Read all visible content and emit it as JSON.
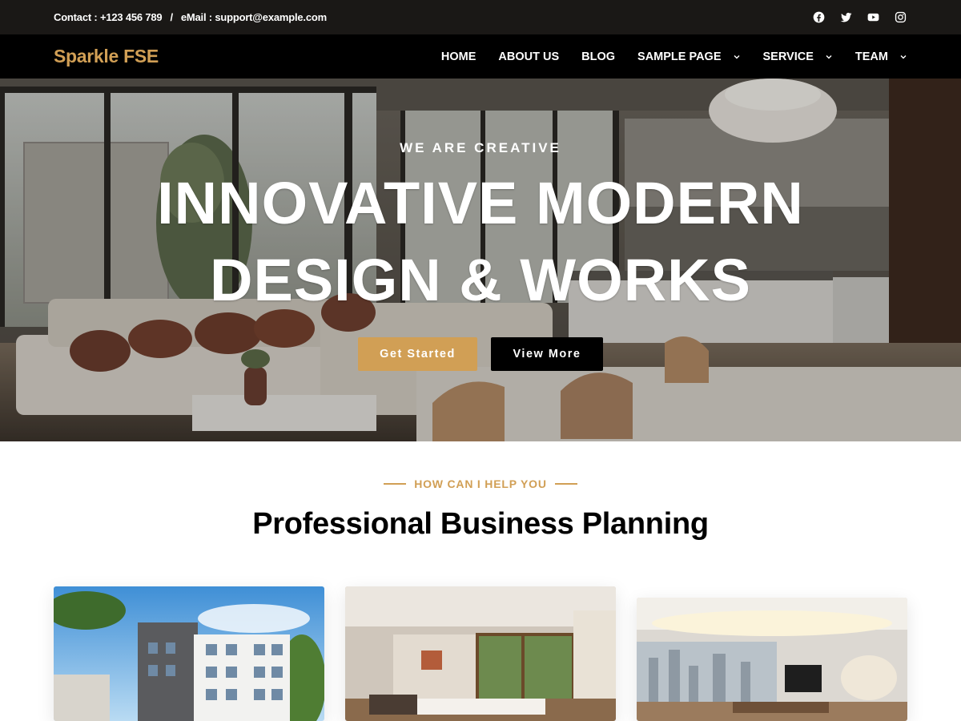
{
  "topbar": {
    "contact": "Contact : +123 456 789",
    "separator": "/",
    "email": "eMail : support@example.com",
    "social_icons": [
      "facebook-icon",
      "twitter-icon",
      "youtube-icon",
      "instagram-icon"
    ]
  },
  "header": {
    "logo": "Sparkle FSE",
    "nav": [
      {
        "label": "HOME",
        "has_dropdown": false
      },
      {
        "label": "ABOUT US",
        "has_dropdown": false
      },
      {
        "label": "BLOG",
        "has_dropdown": false
      },
      {
        "label": "SAMPLE PAGE",
        "has_dropdown": true
      },
      {
        "label": "SERVICE",
        "has_dropdown": true
      },
      {
        "label": "TEAM",
        "has_dropdown": true
      }
    ]
  },
  "hero": {
    "kicker": "WE ARE CREATIVE",
    "title": "INNOVATIVE MODERN DESIGN & WORKS",
    "primary_button": "Get Started",
    "secondary_button": "View More"
  },
  "section": {
    "kicker": "HOW CAN I HELP YOU",
    "title": "Professional Business Planning"
  },
  "colors": {
    "accent": "#d19f55",
    "topbar_bg": "#1a1816",
    "header_bg": "#000000",
    "button_dark": "#000000"
  }
}
